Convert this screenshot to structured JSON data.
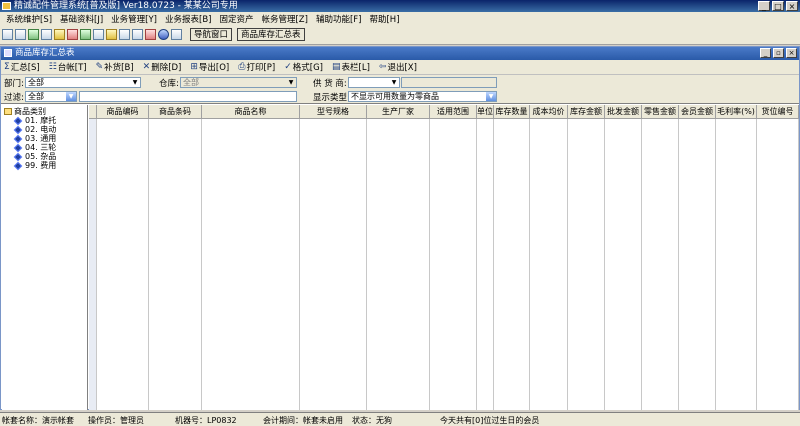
{
  "window": {
    "title": "精诚配件管理系统[普及版] Ver18.0723 - 某某公司专用"
  },
  "menu": [
    "系统维护[S]",
    "基础资料[J]",
    "业务管理[Y]",
    "业务报表[B]",
    "固定资产",
    "帐务管理[Z]",
    "辅助功能[F]",
    "帮助[H]"
  ],
  "quicktoolbar": {
    "nav_label": "导航窗口",
    "summary_label": "商品库存汇总表"
  },
  "child": {
    "title": "商品库存汇总表"
  },
  "actions": [
    {
      "icon": "sum-icon",
      "glyph": "Σ",
      "label": "汇总[S]"
    },
    {
      "icon": "ledger-icon",
      "glyph": "☷",
      "label": "台帐[T]"
    },
    {
      "icon": "restock-icon",
      "glyph": "✎",
      "label": "补货[B]"
    },
    {
      "icon": "delete-icon",
      "glyph": "✕",
      "label": "删除[D]"
    },
    {
      "icon": "export-icon",
      "glyph": "⊞",
      "label": "导出[O]"
    },
    {
      "icon": "print-icon",
      "glyph": "⎙",
      "label": "打印[P]"
    },
    {
      "icon": "format-icon",
      "glyph": "✓",
      "label": "格式[G]"
    },
    {
      "icon": "columns-icon",
      "glyph": "▤",
      "label": "表栏[L]"
    },
    {
      "icon": "exit-icon",
      "glyph": "⇦",
      "label": "退出[X]"
    }
  ],
  "filters": {
    "dept_label": "部门:",
    "dept_value": "全部",
    "warehouse_label": "仓库:",
    "warehouse_value": "全部",
    "supplier_label": "供 货 商:",
    "supplier_value": "",
    "filter_label": "过滤:",
    "filter_value": "全部",
    "display_label": "显示类型:",
    "display_value": "不显示可用数量为零商品"
  },
  "tree": {
    "root": "商品类别",
    "items": [
      "01. 摩托",
      "02. 电动",
      "03. 通用",
      "04. 三轮",
      "05. 杂品",
      "99. 费用"
    ]
  },
  "grid": {
    "columns": [
      "商品编码",
      "商品条码",
      "商品名称",
      "型号规格",
      "生产厂家",
      "适用范围",
      "单位",
      "库存数量",
      "成本均价",
      "库存金额",
      "批发金额",
      "零售金额",
      "会员金额",
      "毛利率(%)",
      "货位编号"
    ]
  },
  "status": {
    "account": "帐套名称：演示帐套",
    "operator": "操作员：管理员",
    "machine": "机器号：LP0832",
    "period": "会计期间：帐套未启用",
    "state": "状态：无狗",
    "birthday": "今天共有[0]位过生日的会员"
  },
  "colors": {
    "title_start": "#0a246a",
    "child_title": "#2a5aa8",
    "toolbar_bg": "#ece9d8"
  }
}
